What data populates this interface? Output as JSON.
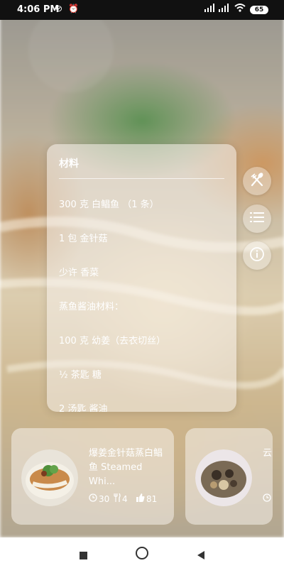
{
  "status_bar": {
    "time": "4:06 PM",
    "battery": "65"
  },
  "ingredients": {
    "title": "材料",
    "items": [
      "300 克 白鲳鱼 （1 条）",
      "1 包 金针菇",
      "少许 香菜",
      "蒸鱼酱油材料：",
      "100 克 幼姜（去衣切丝）",
      "½ 茶匙 糖",
      "2 汤匙 酱油"
    ]
  },
  "side_actions": {
    "icons": [
      "utensils-icon",
      "list-icon",
      "info-icon"
    ]
  },
  "recipes": [
    {
      "title_line1": "爆姜金针菇蒸白鲳",
      "title_line2": "鱼 Steamed Whi...",
      "time": "30",
      "servings": "4",
      "likes": "81"
    },
    {
      "title_partial": "云"
    }
  ],
  "colors": {
    "status_bar": "#111111",
    "nav_bar": "#ffffff",
    "text_on_card": "#ffffff"
  }
}
